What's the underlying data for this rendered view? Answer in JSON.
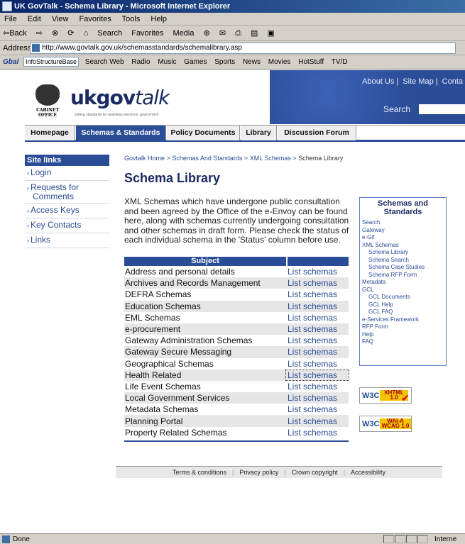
{
  "window": {
    "title": "UK GovTalk - Schema Library - Microsoft Internet Explorer"
  },
  "menu": [
    "File",
    "Edit",
    "View",
    "Favorites",
    "Tools",
    "Help"
  ],
  "toolbar": [
    "⇦Back",
    "⇨",
    "⊗",
    "⟳",
    "⌂",
    "Search",
    "Favorites",
    "Media",
    "⊕",
    "✉",
    "⎙",
    "▤",
    "▣"
  ],
  "address": {
    "label": "Address",
    "url": "http://www.govtalk.gov.uk/schemasstandards/schemalibrary.asp"
  },
  "linksbar": {
    "brand": "Gbal",
    "dropdown": "InfoStructureBase danmar",
    "items": [
      "Search Web",
      "Radio",
      "Music",
      "Games",
      "Sports",
      "News",
      "Movies",
      "HotStuff",
      "TV/D"
    ]
  },
  "header": {
    "logo_word": "ukgov",
    "logo_italic": "talk",
    "crest_text": "CABINET OFFICE",
    "tagline": "setting standards for seamless electronic government",
    "links": [
      "About Us",
      "Site Map",
      "Conta"
    ],
    "search_label": "Search"
  },
  "nav": {
    "tabs": [
      "Homepage",
      "Schemas & Standards",
      "Policy Documents",
      "Library",
      "Discussion Forum"
    ],
    "active": "Schemas & Standards"
  },
  "sidebar": {
    "heading": "Site links",
    "items": [
      "Login",
      "Requests for",
      "Comments",
      "Access Keys",
      "Key Contacts",
      "Links"
    ]
  },
  "breadcrumb": {
    "items": [
      "Govtalk Home",
      "Schemas And Standards",
      "XML Schemas"
    ],
    "current": "Schema Library",
    "separator": ">"
  },
  "main": {
    "title": "Schema Library",
    "intro": "XML Schemas which have undergone public consultation and been agreed by the Office of the e-Envoy can be found here, along with schemas currently undergoing consultation and other schemas in draft form. Please check the status of each individual schema in the 'Status' column before use."
  },
  "table": {
    "header": "Subject",
    "link_label": "List schemas",
    "rows": [
      "Address and personal details",
      "Archives and Records Management",
      "DEFRA Schemas",
      "Education Schemas",
      "EML Schemas",
      "e-procurement",
      "Gateway Administration Schemas",
      "Gateway Secure Messaging",
      "Geographical Schemas",
      "Health Related",
      "Life Event Schemas",
      "Local Government Services",
      "Metadata Schemas",
      "Planning Portal",
      "Property Related Schemas"
    ]
  },
  "rightbox": {
    "title_line1": "Schemas and",
    "title_line2": "Standards",
    "items": [
      {
        "label": "Search",
        "level": 1
      },
      {
        "label": "Gateway",
        "level": 1
      },
      {
        "label": "e-Gif",
        "level": 1
      },
      {
        "label": "XML Schemas",
        "level": 1
      },
      {
        "label": "Schema Library",
        "level": 2
      },
      {
        "label": "Schema Search",
        "level": 2
      },
      {
        "label": "Schema Case Studies",
        "level": 2
      },
      {
        "label": "Schema RFP Form",
        "level": 2
      },
      {
        "label": "Metadata",
        "level": 1
      },
      {
        "label": "GCL",
        "level": 1
      },
      {
        "label": "GCL Documents",
        "level": 2
      },
      {
        "label": "GCL Help",
        "level": 2
      },
      {
        "label": "GCL FAQ",
        "level": 2
      },
      {
        "label": "e-Services Framework",
        "level": 1
      },
      {
        "label": "RFP Form",
        "level": 1
      },
      {
        "label": "Help",
        "level": 1
      },
      {
        "label": "FAQ",
        "level": 1
      }
    ]
  },
  "badges": {
    "xhtml": {
      "w3c": "W3C",
      "line1": "XHTML",
      "line2": "1.0"
    },
    "wai": {
      "w3c": "W3C",
      "line1": "WAI-A",
      "line2": "WCAG 1.0"
    }
  },
  "footer": [
    "Terms & conditions",
    "Privacy policy",
    "Crown copyright",
    "Accessibility"
  ],
  "status": {
    "text": "Done",
    "zone": "Interne"
  }
}
